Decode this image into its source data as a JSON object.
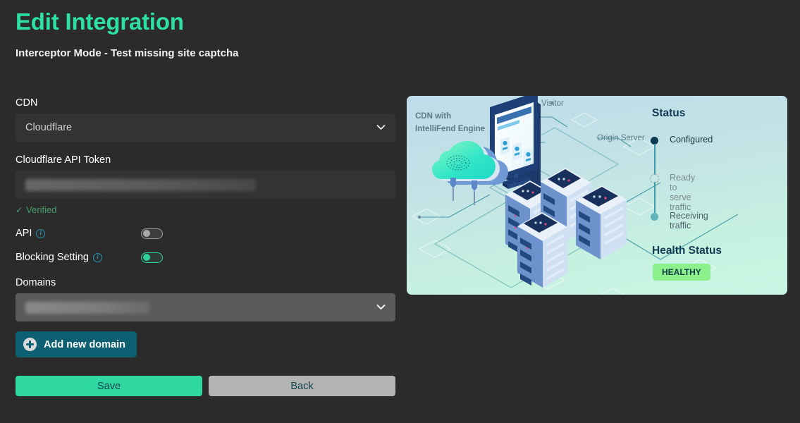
{
  "header": {
    "title": "Edit Integration",
    "subtitle": "Interceptor Mode - Test missing site captcha",
    "title_color": "#2de0a5"
  },
  "form": {
    "cdn": {
      "label": "CDN",
      "selected": "Cloudflare",
      "chevron_icon": "chevron-down-icon"
    },
    "api_token": {
      "label": "Cloudflare API Token",
      "value": "",
      "redacted": true,
      "verified_text": "Verified",
      "verified_icon": "check-icon",
      "verified_color": "#45a06a"
    },
    "api_toggle": {
      "label": "API",
      "info_icon": "info-icon",
      "state": "off"
    },
    "blocking_toggle": {
      "label": "Blocking Setting",
      "info_icon": "info-icon",
      "state": "on"
    },
    "domains": {
      "label": "Domains",
      "selected": "",
      "redacted": true,
      "chevron_icon": "chevron-down-icon"
    },
    "add_domain_button": {
      "label": "Add new domain",
      "icon": "plus-circle-icon",
      "color": "#0d5f72"
    },
    "save_button": {
      "label": "Save",
      "color": "#2fd8a0"
    },
    "back_button": {
      "label": "Back",
      "color": "#b3b3b3"
    }
  },
  "panel": {
    "illustration_labels": {
      "cdn_line1": "CDN with",
      "cdn_line2": "IntelliFend Engine",
      "visitor": "Visitor",
      "origin_server": "Origin Server"
    },
    "status_heading": "Status",
    "steps": [
      {
        "label": "Configured",
        "state": "done"
      },
      {
        "label": "Ready to serve traffic",
        "state": "pending"
      },
      {
        "label": "Receiving traffic",
        "state": "idle"
      }
    ],
    "health_heading": "Health Status",
    "health_badge": "HEALTHY",
    "health_badge_color": "#8cf08c"
  }
}
